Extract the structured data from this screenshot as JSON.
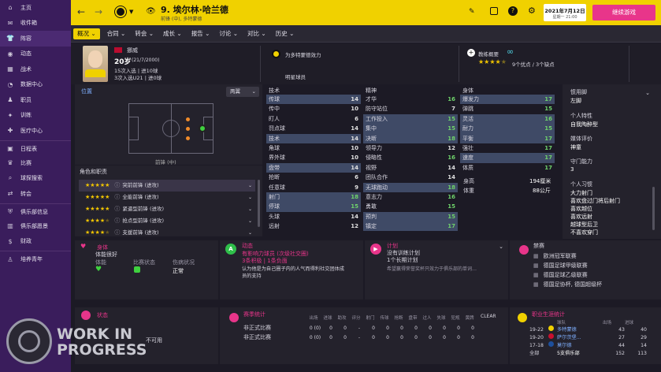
{
  "sidebar": {
    "items": [
      {
        "label": "主页",
        "icon": "home-icon",
        "glyph": "⌂"
      },
      {
        "label": "收件箱",
        "icon": "inbox-icon",
        "glyph": "✉"
      },
      {
        "label": "阵容",
        "icon": "shirt-icon",
        "glyph": "👕"
      },
      {
        "label": "动态",
        "icon": "dynamics-icon",
        "glyph": "◉"
      },
      {
        "label": "战术",
        "icon": "tactics-icon",
        "glyph": "▦"
      },
      {
        "label": "数据中心",
        "icon": "data-icon",
        "glyph": "◔"
      },
      {
        "label": "职员",
        "icon": "staff-icon",
        "glyph": "♟"
      },
      {
        "label": "训练",
        "icon": "training-icon",
        "glyph": "✦"
      },
      {
        "label": "医疗中心",
        "icon": "medical-icon",
        "glyph": "✚"
      },
      {
        "label": "日程表",
        "icon": "calendar-icon",
        "glyph": "▣"
      },
      {
        "label": "比赛",
        "icon": "trophy-icon",
        "glyph": "♛"
      },
      {
        "label": "球探搜索",
        "icon": "scouting-icon",
        "glyph": "⌕"
      },
      {
        "label": "转会",
        "icon": "transfer-icon",
        "glyph": "⇄"
      },
      {
        "label": "俱乐部信息",
        "icon": "club-info-icon",
        "glyph": "⛨"
      },
      {
        "label": "俱乐部愿景",
        "icon": "vision-icon",
        "glyph": "▥"
      },
      {
        "label": "财政",
        "icon": "finance-icon",
        "glyph": "$"
      },
      {
        "label": "培养青年",
        "icon": "youth-icon",
        "glyph": "♙"
      }
    ]
  },
  "topbar": {
    "player_number_name": "9. 埃尔林·哈兰德",
    "player_sub": "前锋 (中), 多特蒙德",
    "date": "2021年7月12日",
    "weekday_time": "星期一 21:00",
    "continue_label": "继续游戏",
    "help": "?"
  },
  "subnav": {
    "tabs": [
      "概况",
      "合同",
      "转会",
      "成长",
      "报告",
      "讨论",
      "对比",
      "历史"
    ]
  },
  "profile": {
    "nation": "挪威",
    "age": "20岁",
    "dob": "(21/7/2000)",
    "caps": "15次入选 | 进10球",
    "u21": "3次入选U21 | 进0球",
    "club_text": "为多特蒙德效力",
    "status": "明星球员",
    "coach_label": "教练概要",
    "rating_text": "9个优点 / 3个缺点"
  },
  "position": {
    "title": "位置",
    "dropdown": "两翼",
    "label": "前锋 (中)"
  },
  "roles": {
    "title": "角色和职责",
    "items": [
      {
        "name": "突前前锋 (进攻)",
        "stars": 5
      },
      {
        "name": "全能前锋 (进攻)",
        "stars": 5
      },
      {
        "name": "紧逼型前锋 (进攻)",
        "stars": 5
      },
      {
        "name": "抢点型前锋 (进攻)",
        "stars": 4
      },
      {
        "name": "支援前锋 (进攻)",
        "stars": 4
      }
    ]
  },
  "attributes": {
    "technical": {
      "title": "技术",
      "rows": [
        {
          "name": "传球",
          "value": "14",
          "c": "w",
          "hl": true
        },
        {
          "name": "传中",
          "value": "10",
          "c": "w",
          "hl": false
        },
        {
          "name": "盯人",
          "value": "6",
          "c": "w",
          "hl": false
        },
        {
          "name": "罚点球",
          "value": "14",
          "c": "w",
          "hl": false
        },
        {
          "name": "技术",
          "value": "14",
          "c": "w",
          "hl": true
        },
        {
          "name": "角球",
          "value": "10",
          "c": "w",
          "hl": false
        },
        {
          "name": "界外球",
          "value": "10",
          "c": "w",
          "hl": false
        },
        {
          "name": "盘带",
          "value": "14",
          "c": "w",
          "hl": true
        },
        {
          "name": "抢断",
          "value": "6",
          "c": "w",
          "hl": false
        },
        {
          "name": "任意球",
          "value": "9",
          "c": "w",
          "hl": false
        },
        {
          "name": "射门",
          "value": "18",
          "c": "g",
          "hl": true
        },
        {
          "name": "停球",
          "value": "15",
          "c": "g",
          "hl": true
        },
        {
          "name": "头球",
          "value": "14",
          "c": "w",
          "hl": false
        },
        {
          "name": "远射",
          "value": "12",
          "c": "w",
          "hl": false
        }
      ]
    },
    "mental": {
      "title": "精神",
      "rows": [
        {
          "name": "才华",
          "value": "16",
          "c": "g",
          "hl": false
        },
        {
          "name": "防守站位",
          "value": "7",
          "c": "w",
          "hl": false
        },
        {
          "name": "工作投入",
          "value": "15",
          "c": "g",
          "hl": true
        },
        {
          "name": "集中",
          "value": "15",
          "c": "g",
          "hl": true
        },
        {
          "name": "决断",
          "value": "18",
          "c": "g",
          "hl": true
        },
        {
          "name": "领导力",
          "value": "12",
          "c": "w",
          "hl": false
        },
        {
          "name": "侵略性",
          "value": "16",
          "c": "g",
          "hl": false
        },
        {
          "name": "视野",
          "value": "14",
          "c": "w",
          "hl": false
        },
        {
          "name": "团队合作",
          "value": "14",
          "c": "w",
          "hl": false
        },
        {
          "name": "无球跑动",
          "value": "18",
          "c": "g",
          "hl": true
        },
        {
          "name": "意志力",
          "value": "16",
          "c": "g",
          "hl": false
        },
        {
          "name": "勇敢",
          "value": "15",
          "c": "g",
          "hl": false
        },
        {
          "name": "预判",
          "value": "15",
          "c": "g",
          "hl": true
        },
        {
          "name": "镇定",
          "value": "17",
          "c": "g",
          "hl": true
        }
      ]
    },
    "physical": {
      "title": "身体",
      "rows": [
        {
          "name": "爆发力",
          "value": "17",
          "c": "g",
          "hl": true
        },
        {
          "name": "弹跳",
          "value": "15",
          "c": "g",
          "hl": false
        },
        {
          "name": "灵活",
          "value": "16",
          "c": "g",
          "hl": true
        },
        {
          "name": "耐力",
          "value": "15",
          "c": "g",
          "hl": true
        },
        {
          "name": "平衡",
          "value": "17",
          "c": "g",
          "hl": true
        },
        {
          "name": "强壮",
          "value": "17",
          "c": "g",
          "hl": false
        },
        {
          "name": "速度",
          "value": "17",
          "c": "g",
          "hl": true
        },
        {
          "name": "体质",
          "value": "17",
          "c": "g",
          "hl": false
        }
      ]
    },
    "height_label": "身高",
    "height": "194厘米",
    "weight_label": "体重",
    "weight": "88公斤"
  },
  "right_panel": {
    "foot_title": "惯用脚",
    "foot": "左脚",
    "traits_title": "个人特性",
    "traits": "自我陶醉型",
    "media_title": "媒体评价",
    "media": "神童",
    "keeper_title": "守门能力",
    "keeper": "3",
    "habits_title": "个人习惯",
    "habits": [
      "大力射门",
      "喜欢盘过门将后射门",
      "喜欢越位",
      "喜欢远射",
      "越球型后卫",
      "不喜欢穿门"
    ]
  },
  "bottom": {
    "body": {
      "title": "身体",
      "sub": "体能很好",
      "c1": "体能",
      "c2": "比赛状态",
      "c3": "伤病状况",
      "c3v": "正常"
    },
    "dyn": {
      "title": "动态",
      "line1": "有影响力球员 (次级社交圈)",
      "line2": "3条积极 | 1条负面",
      "desc1": "认为他是为自己圈子内的人气而得利社交团体成",
      "desc2": "员的支持"
    },
    "plan": {
      "title": "计划",
      "line1": "没有训练计划",
      "line2": "1个长期计划",
      "desc": "希望赢得荣誉奖杯只效力于俱乐部的单词…"
    },
    "comp": {
      "title": "禁赛",
      "items": [
        "欧洲冠军联赛",
        "德国足球甲级联赛",
        "德国足球乙级联赛",
        "德国足协杯, 德国超级杯"
      ]
    },
    "status": {
      "title": "状态",
      "value": "不可用"
    },
    "season": {
      "title": "赛季统计",
      "headers": [
        "出场",
        "进球",
        "助攻",
        "评分",
        "射门",
        "传球",
        "抢断",
        "盘带",
        "过人",
        "失球",
        "犯规",
        "黄牌"
      ],
      "clear": "CLEAR",
      "rows": [
        {
          "name": "非正式比赛",
          "values": [
            "0 (0)",
            "0",
            "0",
            "-",
            "0",
            "0",
            "0",
            "0",
            "0",
            "0",
            "0",
            "0"
          ]
        },
        {
          "name": "非正式比赛",
          "values": [
            "0 (0)",
            "0",
            "0",
            "-",
            "0",
            "0",
            "0",
            "0",
            "0",
            "0",
            "0",
            "0"
          ]
        }
      ]
    },
    "career": {
      "title": "职业生涯统计",
      "h_season": "球队",
      "h_apps": "出场",
      "h_goals": "进球",
      "rows": [
        {
          "yr": "19-22",
          "team": "多特蒙德",
          "apps": "43",
          "goals": "40"
        },
        {
          "yr": "19-20",
          "team": "萨尔茨堡...",
          "apps": "27",
          "goals": "29"
        },
        {
          "yr": "17-18",
          "team": "莫尔德",
          "apps": "44",
          "goals": "14"
        },
        {
          "yr": "全部",
          "team": "5支俱乐部",
          "apps": "152",
          "goals": "113"
        }
      ]
    }
  },
  "watermark": {
    "line1": "WORK IN",
    "line2": "PROGRESS"
  },
  "colors": {
    "sidebar": "#3a1d5c",
    "topbar": "#f0d100",
    "panel": "#24222c",
    "highlight": "#3f4a66"
  }
}
